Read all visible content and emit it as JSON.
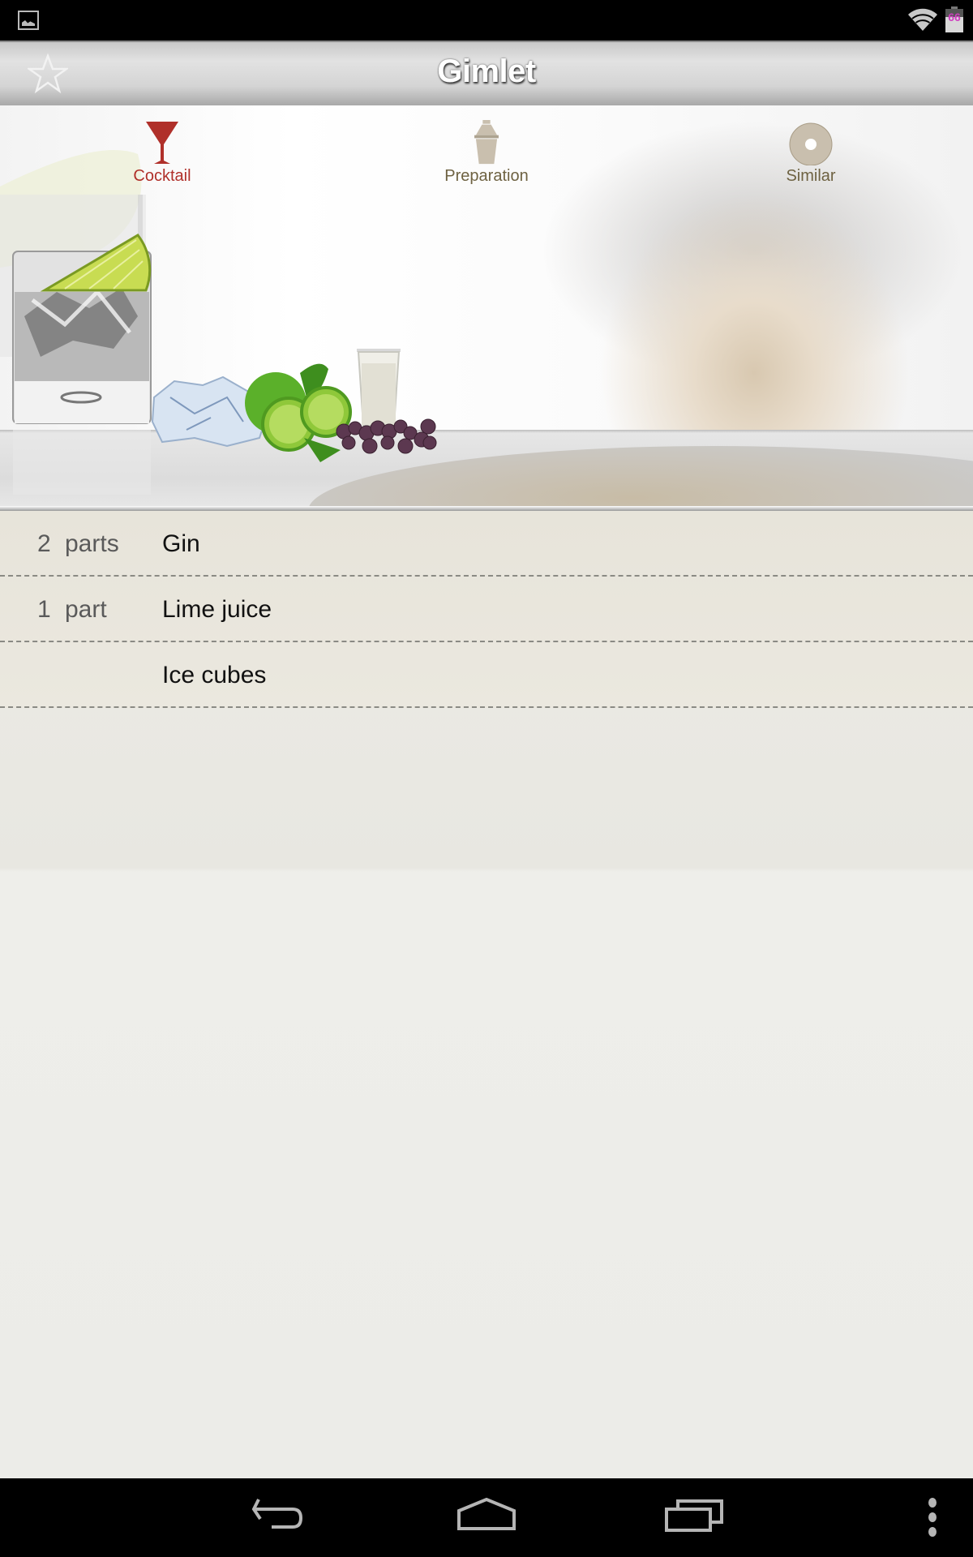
{
  "status_bar": {
    "notification_icon": "image-icon",
    "wifi_icon": "wifi-icon",
    "battery_level": "66",
    "battery_percent": 0.66
  },
  "header": {
    "title": "Gimlet",
    "favorite_icon": "star-outline-icon"
  },
  "tabs": [
    {
      "label": "Cocktail",
      "icon": "martini-glass-icon",
      "active": true,
      "color": "#b0302a"
    },
    {
      "label": "Preparation",
      "icon": "shaker-icon",
      "active": false,
      "color": "#6e6242"
    },
    {
      "label": "Similar",
      "icon": "disc-icon",
      "active": false,
      "color": "#6e6242"
    }
  ],
  "hero_image": "cocktail-ingredients-illustration",
  "ingredients": [
    {
      "qty": "2",
      "unit": "parts",
      "name": "Gin"
    },
    {
      "qty": "1",
      "unit": "part",
      "name": "Lime juice"
    },
    {
      "qty": "",
      "unit": "",
      "name": "Ice cubes"
    }
  ],
  "nav_bar": {
    "back": "back-icon",
    "home": "home-icon",
    "recents": "recents-icon",
    "menu": "overflow-menu-icon"
  }
}
